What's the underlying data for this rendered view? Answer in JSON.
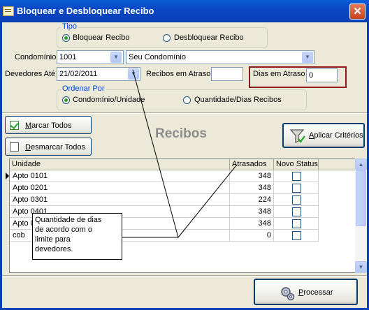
{
  "window": {
    "title": "Bloquear e Desbloquear Recibo",
    "close_symbol": "✕"
  },
  "tipo": {
    "legend": "Tipo",
    "options": [
      "Bloquear Recibo",
      "Desbloquear Recibo"
    ],
    "selected": "Bloquear Recibo"
  },
  "condominio": {
    "label": "Condomínio",
    "code": "1001",
    "name": "Seu Condomínio"
  },
  "devedores": {
    "label": "Devedores Até",
    "date": "21/02/2011"
  },
  "recibos_atraso": {
    "label": "Recibos em Atraso",
    "value": ""
  },
  "dias_atraso": {
    "label": "Dias em Atraso",
    "value": "0"
  },
  "ordenar": {
    "legend": "Ordenar Por",
    "options": [
      "Condomínio/Unidade",
      "Quantidade/Dias Recibos"
    ],
    "selected": "Condomínio/Unidade"
  },
  "buttons": {
    "marcar": "Marcar Todos",
    "desmarcar": "Desmarcar Todos",
    "aplicar": "Aplicar Critérios",
    "processar": "Processar"
  },
  "section_title": "Recibos",
  "table": {
    "columns": [
      "Unidade",
      "Atrasados",
      "Novo Status"
    ],
    "rows": [
      {
        "unidade": "Apto 0101",
        "atrasados": "348"
      },
      {
        "unidade": "Apto 0201",
        "atrasados": "348"
      },
      {
        "unidade": "Apto 0301",
        "atrasados": "224"
      },
      {
        "unidade": "Apto 0401",
        "atrasados": "348"
      },
      {
        "unidade": "Apto 0",
        "atrasados": "348"
      },
      {
        "unidade": "cob",
        "atrasados": "0"
      }
    ]
  },
  "tooltip": {
    "text": "Quantidade de dias\nde acordo com o\nlimite para\ndevedores."
  },
  "colors": {
    "titlebar": "#0a47c7",
    "highlight_border": "#8b1a1a",
    "section_title": "#8c8c8c",
    "legend": "#0046d5"
  }
}
